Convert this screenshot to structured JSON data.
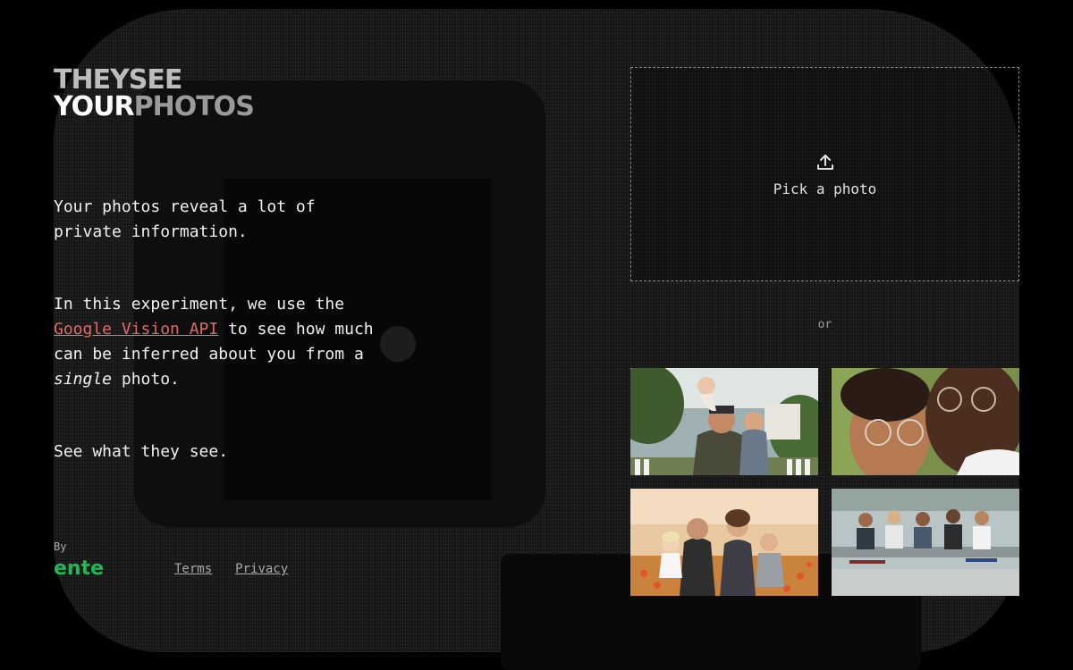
{
  "logo": {
    "line1": "THEYSEE",
    "line2a": "YOUR",
    "line2b": "PHOTOS"
  },
  "intro": {
    "p1": "Your photos reveal a lot of private information.",
    "p2_before": "In this experiment, we use the ",
    "p2_link": "Google Vision API",
    "p2_after": " to see how much can be inferred about you from a ",
    "p2_em": "single",
    "p2_end": " photo.",
    "p3": "See what they see."
  },
  "footer": {
    "by": "By",
    "brand": "ente",
    "terms": "Terms",
    "privacy": "Privacy"
  },
  "upload": {
    "label": "Pick a photo",
    "icon": "upload-icon"
  },
  "or_text": "or",
  "samples": [
    "family-on-shoulders",
    "couple-closeup",
    "family-in-field",
    "group-skateboards"
  ],
  "colors": {
    "accent_link": "#e06a6a",
    "brand": "#1db954",
    "background": "#000000"
  }
}
